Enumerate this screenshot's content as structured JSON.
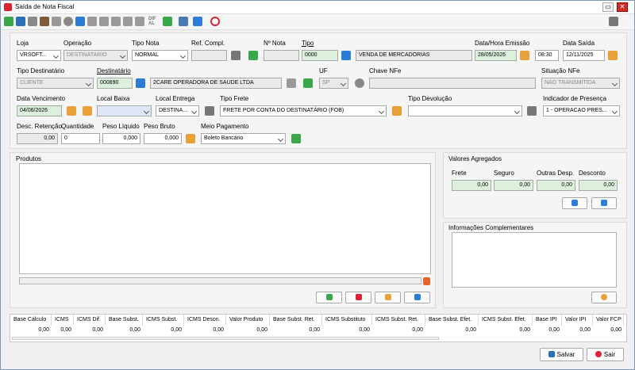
{
  "window": {
    "title": "Saída de Nota Fiscal"
  },
  "toolbar": {
    "dif_label": "DIF",
    "al_label": "AL"
  },
  "header": {
    "loja": {
      "label": "Loja",
      "value": "VRSOFT..."
    },
    "operacao": {
      "label": "Operação",
      "value": "DESTINATARIO"
    },
    "tipo_nota": {
      "label": "Tipo Nota",
      "value": "NORMAL"
    },
    "ref_compl": {
      "label": "Ref. Compl.",
      "value": ""
    },
    "num_nota": {
      "label": "Nº Nota",
      "value": ""
    },
    "tipo": {
      "label": "Tipo",
      "code": "0000",
      "desc": "VENDA DE MERCADORIAS"
    },
    "data_emissao": {
      "label": "Data/Hora Emissão",
      "date": "28/05/2026",
      "time": "08:30"
    },
    "data_saida": {
      "label": "Data Saída",
      "value": "12/11/2025"
    },
    "tipo_dest": {
      "label": "Tipo Destinatário",
      "value": "CLIENTE"
    },
    "destinatario": {
      "label": "Destinatário",
      "code": "000890",
      "name": "2CARE OPERADORA DE SAUDE LTDA"
    },
    "uf": {
      "label": "UF",
      "value": "SP"
    },
    "chave": {
      "label": "Chave NFe",
      "value": ""
    },
    "situacao": {
      "label": "Situação NFe",
      "value": "NAO TRANSMITIDA"
    },
    "data_venc": {
      "label": "Data Vencimento",
      "value": "04/06/2026"
    },
    "local_baixa": {
      "label": "Local Baixa",
      "value": ""
    },
    "local_entrega": {
      "label": "Local Entrega",
      "value": "DESTINA..."
    },
    "tipo_frete": {
      "label": "Tipo Frete",
      "value": "FRETE POR CONTA DO DESTINATÁRIO (FOB)"
    },
    "tipo_devol": {
      "label": "Tipo Devolução",
      "value": ""
    },
    "ind_presenca": {
      "label": "Indicador de Presença",
      "value": "1 - OPERACAO PRES..."
    },
    "desc_ret": {
      "label": "Desc. Retenção",
      "value": "0,00"
    },
    "quantidade": {
      "label": "Quantidade",
      "value": "0"
    },
    "peso_liq": {
      "label": "Peso Líquido",
      "value": "0,000"
    },
    "peso_bruto": {
      "label": "Peso Bruto",
      "value": "0,000"
    },
    "meio_pag": {
      "label": "Meio Pagamento",
      "value": "Boleto Bancário"
    }
  },
  "produtos": {
    "title": "Produtos"
  },
  "valores": {
    "title": "Valores Agregados",
    "frete_label": "Frete",
    "frete": "0,00",
    "seguro_label": "Seguro",
    "seguro": "0,00",
    "outras_label": "Outras Desp.",
    "outras": "0,00",
    "desconto_label": "Desconto",
    "desconto": "0,00"
  },
  "info": {
    "title": "Informações Complementares"
  },
  "totals": {
    "headers": [
      "Base Cálculo",
      "ICMS",
      "ICMS Dif.",
      "Base Subst.",
      "ICMS Subst.",
      "ICMS Deson.",
      "Valor Produto",
      "Base Subst. Ret.",
      "ICMS Substituto",
      "ICMS Subst. Ret.",
      "Base Subst. Efet.",
      "ICMS Subst. Efet.",
      "Base IPI",
      "Valor IPI",
      "Valor FCP"
    ],
    "values": [
      "0,00",
      "0,00",
      "0,00",
      "0,00",
      "0,00",
      "0,00",
      "0,00",
      "0,00",
      "0,00",
      "0,00",
      "0,00",
      "0,00",
      "0,00",
      "0,00",
      "0,00"
    ]
  },
  "footer": {
    "save": "Salvar",
    "exit": "Sair"
  },
  "colors": {
    "green_field": "#dcf0dc",
    "accent_orange": "#e8a13a",
    "accent_red": "#d23",
    "accent_blue": "#2c7bd6",
    "accent_green": "#3aa84a"
  }
}
